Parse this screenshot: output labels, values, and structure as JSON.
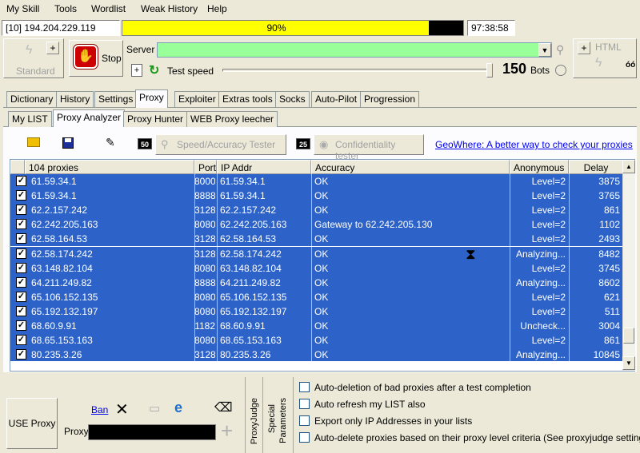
{
  "menu": [
    "My Skill",
    "Tools",
    "Wordlist",
    "Weak History",
    "Help"
  ],
  "status": {
    "ip": "[10] 194.204.229.119",
    "progress_text": "90%",
    "progress_fraction": 0.9,
    "clock": "97:38:58"
  },
  "toolbar": {
    "standard_label": "Standard",
    "plus_label": "+",
    "stop_label": "Stop",
    "server_label": "Server",
    "server_value": "",
    "test_speed_label": "Test speed",
    "bots_count": "150",
    "bots_label": "Bots",
    "html_label": "HTML",
    "oc_label": "óó"
  },
  "tabs_main": [
    "Dictionary",
    "History",
    "Settings",
    "Proxy",
    "Exploiter",
    "Extras tools",
    "Socks",
    "Auto-Pilot",
    "Progression"
  ],
  "tabs_sub": [
    "My LIST",
    "Proxy Analyzer",
    "Proxy Hunter",
    "WEB Proxy leecher"
  ],
  "analyzer": {
    "badge_50": "50",
    "badge_25": "25",
    "speed_tester": "Speed/Accuracy Tester",
    "conf_tester": "Confidentiality tester",
    "geowhere": "GeoWhere: A better way to check your proxies"
  },
  "table": {
    "headers": [
      "104 proxies",
      "Port",
      "IP Addr",
      "Accuracy",
      "Anonymous",
      "Delay"
    ],
    "rows": [
      {
        "proxy": "61.59.34.1",
        "port": "8000",
        "ip": "61.59.34.1",
        "accuracy": "OK",
        "anon": "Level=2",
        "delay": "3875"
      },
      {
        "proxy": "61.59.34.1",
        "port": "8888",
        "ip": "61.59.34.1",
        "accuracy": "OK",
        "anon": "Level=2",
        "delay": "3765"
      },
      {
        "proxy": "62.2.157.242",
        "port": "3128",
        "ip": "62.2.157.242",
        "accuracy": "OK",
        "anon": "Level=2",
        "delay": "861"
      },
      {
        "proxy": "62.242.205.163",
        "port": "8080",
        "ip": "62.242.205.163",
        "accuracy": "Gateway to 62.242.205.130",
        "anon": "Level=2",
        "delay": "1102"
      },
      {
        "proxy": "62.58.164.53",
        "port": "3128",
        "ip": "62.58.164.53",
        "accuracy": "OK",
        "anon": "Level=2",
        "delay": "2493"
      },
      {
        "proxy": "62.58.174.242",
        "port": "3128",
        "ip": "62.58.174.242",
        "accuracy": "OK",
        "anon": "Analyzing...",
        "delay": "8482"
      },
      {
        "proxy": "63.148.82.104",
        "port": "8080",
        "ip": "63.148.82.104",
        "accuracy": "OK",
        "anon": "Level=2",
        "delay": "3745"
      },
      {
        "proxy": "64.211.249.82",
        "port": "8888",
        "ip": "64.211.249.82",
        "accuracy": "OK",
        "anon": "Analyzing...",
        "delay": "8602"
      },
      {
        "proxy": "65.106.152.135",
        "port": "8080",
        "ip": "65.106.152.135",
        "accuracy": "OK",
        "anon": "Level=2",
        "delay": "621"
      },
      {
        "proxy": "65.192.132.197",
        "port": "8080",
        "ip": "65.192.132.197",
        "accuracy": "OK",
        "anon": "Level=2",
        "delay": "511"
      },
      {
        "proxy": "68.60.9.91",
        "port": "1182",
        "ip": "68.60.9.91",
        "accuracy": "OK",
        "anon": "Uncheck...",
        "delay": "3004"
      },
      {
        "proxy": "68.65.153.163",
        "port": "8080",
        "ip": "68.65.153.163",
        "accuracy": "OK",
        "anon": "Level=2",
        "delay": "861"
      },
      {
        "proxy": "80.235.3.26",
        "port": "3128",
        "ip": "80.235.3.26",
        "accuracy": "OK",
        "anon": "Analyzing...",
        "delay": "10845"
      }
    ]
  },
  "bottom": {
    "use_proxy": "USE Proxy",
    "ban": "Ban",
    "proxy_label": "Proxy",
    "proxyjudge": "ProxyJudge",
    "special": "Special",
    "parameters": "Parameters",
    "options": [
      "Auto-deletion of bad proxies after a test completion",
      "Auto refresh my LIST also",
      "Export only IP Addresses in your lists",
      "Auto-delete proxies based on their proxy level criteria (See proxyjudge settings)"
    ]
  },
  "colors": {
    "row_selected": "#2d63c8",
    "server_field": "#99ff99",
    "progress_fill": "#ffff00",
    "link": "#0000ee"
  }
}
